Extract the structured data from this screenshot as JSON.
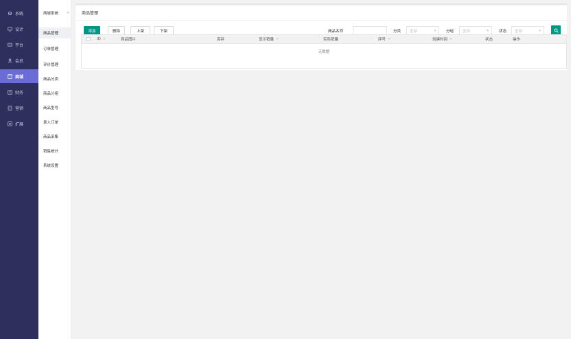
{
  "sidebar": {
    "items": [
      {
        "label": "系统",
        "icon": "gear-icon",
        "active": false
      },
      {
        "label": "设计",
        "icon": "monitor-icon",
        "active": false
      },
      {
        "label": "平台",
        "icon": "platform-icon",
        "active": false
      },
      {
        "label": "会员",
        "icon": "user-icon",
        "active": false
      },
      {
        "label": "商城",
        "icon": "shop-icon",
        "active": true
      },
      {
        "label": "财务",
        "icon": "finance-icon",
        "active": false
      },
      {
        "label": "营销",
        "icon": "marketing-icon",
        "active": false
      },
      {
        "label": "扩展",
        "icon": "extend-icon",
        "active": false
      }
    ]
  },
  "submenu": {
    "header": "商城系统",
    "collapse_icon": "«",
    "items": [
      {
        "label": "商品管理",
        "active": true
      },
      {
        "label": "订单管理",
        "active": false
      },
      {
        "label": "评价管理",
        "active": false
      },
      {
        "label": "商品分类",
        "active": false
      },
      {
        "label": "商品分组",
        "active": false
      },
      {
        "label": "商品型号",
        "active": false
      },
      {
        "label": "录入订单",
        "active": false
      },
      {
        "label": "商品采集",
        "active": false
      },
      {
        "label": "销售统计",
        "active": false
      },
      {
        "label": "系统设置",
        "active": false
      }
    ]
  },
  "page": {
    "title": "商品管理"
  },
  "toolbar": {
    "add": "添加",
    "delete": "删除",
    "on_shelf": "上架",
    "off_shelf": "下架"
  },
  "filters": {
    "name_label": "商品名称",
    "name_value": "",
    "category_label": "分类",
    "category_value": "全部",
    "group_label": "分组",
    "group_value": "全部",
    "status_label": "状态",
    "status_value": "全部"
  },
  "table": {
    "columns": {
      "id": "ID",
      "image": "商品图片",
      "stock": "库存",
      "shown_sales": "显示销量",
      "actual_sales": "实际销量",
      "order": "序号",
      "created": "创建时间",
      "status": "状态",
      "actions": "操作"
    },
    "sort_glyph": "÷",
    "empty_text": "无数据"
  },
  "colors": {
    "sidebar_bg": "#2f2f5e",
    "accent": "#6c6cd6",
    "primary": "#009688"
  }
}
